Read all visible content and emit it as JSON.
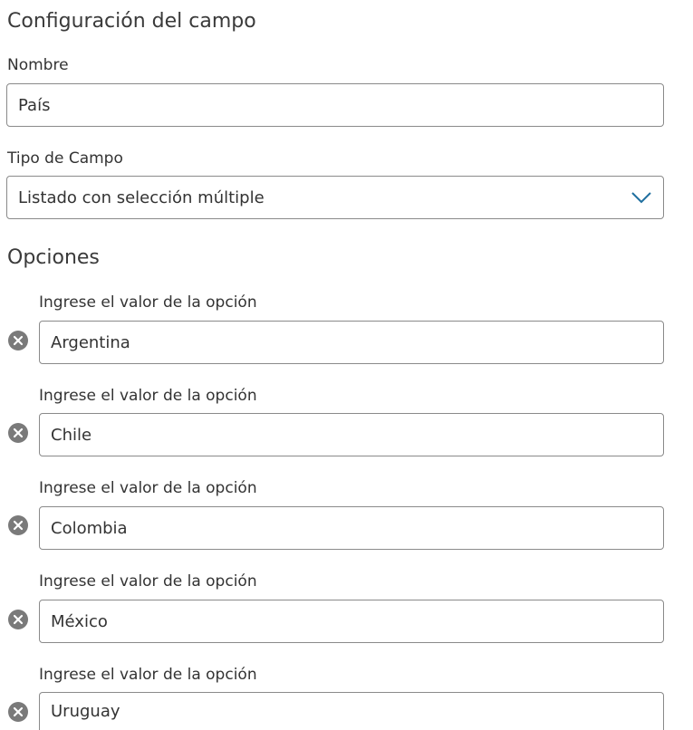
{
  "header": {
    "title": "Configuración del campo"
  },
  "name_field": {
    "label": "Nombre",
    "value": "País"
  },
  "type_field": {
    "label": "Tipo de Campo",
    "value": "Listado con selección múltiple"
  },
  "options": {
    "title": "Opciones",
    "items": [
      {
        "label": "Ingrese el valor de la opción",
        "value": "Argentina"
      },
      {
        "label": "Ingrese el valor de la opción",
        "value": "Chile"
      },
      {
        "label": "Ingrese el valor de la opción",
        "value": "Colombia"
      },
      {
        "label": "Ingrese el valor de la opción",
        "value": "México"
      },
      {
        "label": "Ingrese el valor de la opción",
        "value": "Uruguay"
      }
    ]
  },
  "colors": {
    "text": "#333333",
    "border": "#8a8a8a",
    "remove_icon": "#7a7a7a",
    "chevron": "#1f6f9f"
  },
  "icons": {
    "remove": "remove-circle-icon",
    "dropdown": "chevron-down-icon"
  }
}
